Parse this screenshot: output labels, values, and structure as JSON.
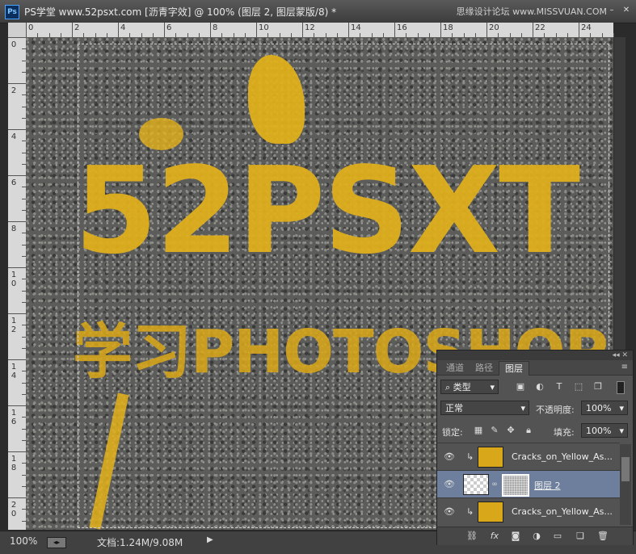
{
  "window": {
    "app_icon": "Ps",
    "title": "PS学堂 www.52psxt.com [沥青字效] @ 100% (图层 2, 图层蒙版/8) *",
    "watermark": "思缘设计论坛 www.MISSVUAN.COM",
    "minimize": "–",
    "close": "✕"
  },
  "ruler": {
    "h_labels": [
      "0",
      "2",
      "4",
      "6",
      "8",
      "10",
      "12",
      "14",
      "16",
      "18",
      "20",
      "22",
      "24"
    ],
    "v_labels": [
      "0",
      "2",
      "4",
      "6",
      "8",
      "1\n0",
      "1\n2",
      "1\n4",
      "1\n6",
      "1\n8",
      "2\n0"
    ]
  },
  "canvas": {
    "headline": "52PSXT",
    "subline": "学习PHOTOSHOP",
    "paint_color": "#e3b21a",
    "asphalt_color": "#5c5d5b"
  },
  "status": {
    "zoom": "100%",
    "doc_info": "文档:1.24M/9.08M"
  },
  "layers_panel": {
    "collapse_icon": "◂◂ ✕",
    "tabs": [
      {
        "label": "通道",
        "active": false
      },
      {
        "label": "路径",
        "active": false
      },
      {
        "label": "图层",
        "active": true
      }
    ],
    "menu_icon": "≡",
    "filter": {
      "label": "类型",
      "icon": "search-icon"
    },
    "blend_mode": "正常",
    "opacity_label": "不透明度:",
    "opacity_value": "100%",
    "lock_label": "锁定:",
    "fill_label": "填充:",
    "fill_value": "100%",
    "layers": [
      {
        "name": "Cracks_on_Yellow_As...",
        "clipped": true,
        "selected": false,
        "thumb": "yellow"
      },
      {
        "name": "图层 2",
        "clipped": false,
        "selected": true,
        "thumb": "check",
        "has_mask": true
      },
      {
        "name": "Cracks_on_Yellow_As...",
        "clipped": true,
        "selected": false,
        "thumb": "yellow"
      }
    ]
  }
}
